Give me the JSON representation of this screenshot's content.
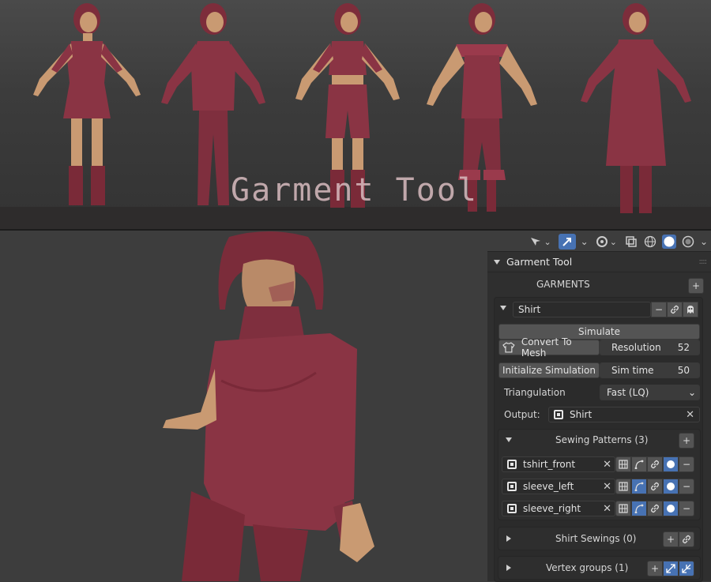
{
  "banner": {
    "title": "Garment Tool"
  },
  "viewport": {
    "header_icons": [
      "select-tool-icon",
      "transform-gizmo-icon",
      "overlay-icon",
      "xray-icon",
      "wireframe-shading-icon",
      "solid-shading-icon",
      "material-shading-icon"
    ]
  },
  "panel": {
    "title": "Garment Tool",
    "garments_label": "GARMENTS",
    "garment_name": "Shirt",
    "simulate_label": "Simulate",
    "convert_label": "Convert To Mesh",
    "resolution_label": "Resolution",
    "resolution_value": "52",
    "init_sim_label": "Initialize Simulation",
    "sim_time_label": "Sim time",
    "sim_time_value": "50",
    "triangulation_label": "Triangulation",
    "triangulation_value": "Fast (LQ)",
    "output_label": "Output:",
    "output_value": "Shirt",
    "sewing_patterns_label": "Sewing Patterns (3)",
    "patterns": [
      {
        "name": "tshirt_front"
      },
      {
        "name": "sleeve_left"
      },
      {
        "name": "sleeve_right"
      }
    ],
    "sewings_label": "Shirt Sewings (0)",
    "vertex_groups_label": "Vertex groups (1)"
  },
  "colors": {
    "accent": "#4772b3",
    "garment": "#8a3444",
    "skin": "#c99a72"
  }
}
